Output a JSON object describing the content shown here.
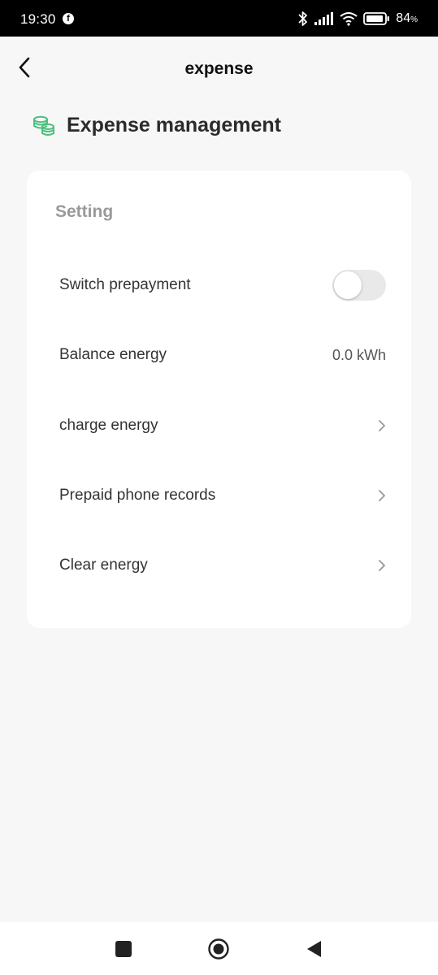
{
  "status_bar": {
    "time": "19:30",
    "battery_percent": "84",
    "battery_unit": "%",
    "icons": [
      "facebook-icon",
      "bluetooth-icon",
      "signal-icon",
      "wifi-icon",
      "battery-icon"
    ]
  },
  "header": {
    "title": "expense",
    "back_icon": "chevron-left-icon"
  },
  "section": {
    "title": "Expense management",
    "icon": "coins-icon",
    "icon_color": "#4cbf7e"
  },
  "card": {
    "heading": "Setting",
    "rows": [
      {
        "label": "Switch prepayment",
        "control": "toggle",
        "toggle_on": false
      },
      {
        "label": "Balance energy",
        "value": "0.0 kWh"
      },
      {
        "label": "charge energy",
        "control": "chevron"
      },
      {
        "label": "Prepaid phone records",
        "control": "chevron"
      },
      {
        "label": "Clear energy",
        "control": "chevron"
      }
    ]
  },
  "nav_bar": {
    "buttons": [
      "recent-apps-icon",
      "home-icon",
      "back-triangle-icon"
    ]
  }
}
